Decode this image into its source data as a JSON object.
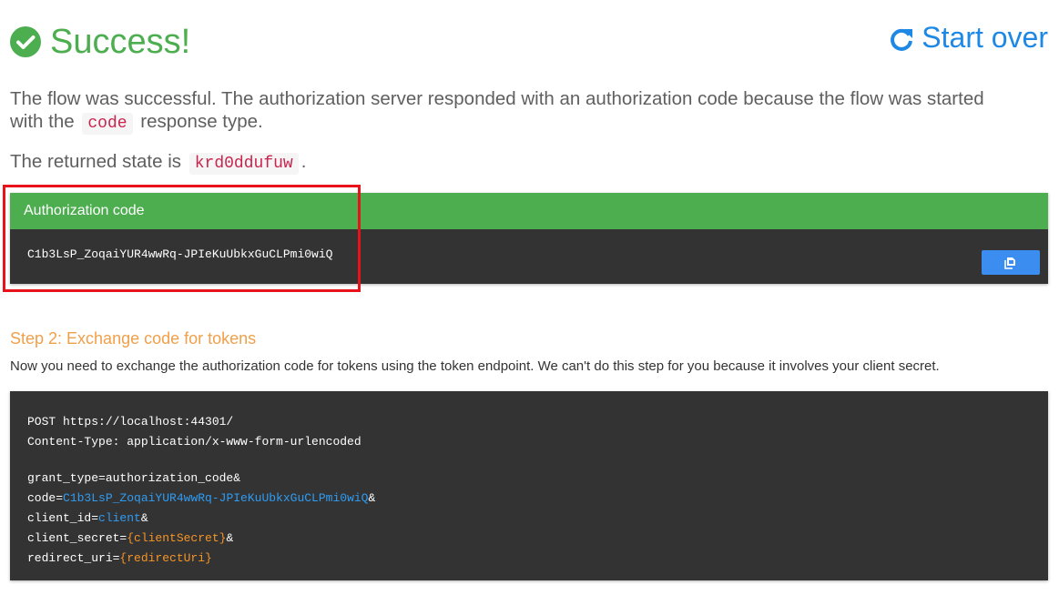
{
  "header": {
    "title": "Success!",
    "start_over_label": "Start over"
  },
  "intro": {
    "text_before": "The flow was successful. The authorization server responded with an authorization code because the flow was started with the",
    "response_type": "code",
    "text_after": "response type."
  },
  "state": {
    "label": "The returned state is",
    "value": "krd0ddufuw",
    "suffix": "."
  },
  "auth_card": {
    "heading": "Authorization code",
    "code": "C1b3LsP_ZoqaiYUR4wwRq-JPIeKuUbkxGuCLPmi0wiQ"
  },
  "step2": {
    "heading": "Step 2: Exchange code for tokens",
    "description": "Now you need to exchange the authorization code for tokens using the token endpoint. We can't do this step for you because it involves your client secret."
  },
  "request": {
    "line1": "POST https://localhost:44301/",
    "line2": "Content-Type: application/x-www-form-urlencoded",
    "grant_line": "grant_type=authorization_code&",
    "code_key": "code=",
    "code_value": "C1b3LsP_ZoqaiYUR4wwRq-JPIeKuUbkxGuCLPmi0wiQ",
    "code_suffix": "&",
    "client_id_key": "client_id=",
    "client_id_value": "client",
    "client_id_suffix": "&",
    "client_secret_key": "client_secret=",
    "client_secret_value": "{clientSecret}",
    "client_secret_suffix": "&",
    "redirect_uri_key": "redirect_uri=",
    "redirect_uri_value": "{redirectUri}"
  },
  "colors": {
    "success": "#4cae4f",
    "link": "#1e88e5",
    "step_heading": "#f0a04b",
    "code_bg": "#333333",
    "highlight": "#e8121a",
    "value_blue": "#2f9cf4",
    "value_orange": "#f59526"
  },
  "icons": {
    "title": "check-circle-icon",
    "start_over": "refresh-icon",
    "copy": "copy-icon"
  }
}
